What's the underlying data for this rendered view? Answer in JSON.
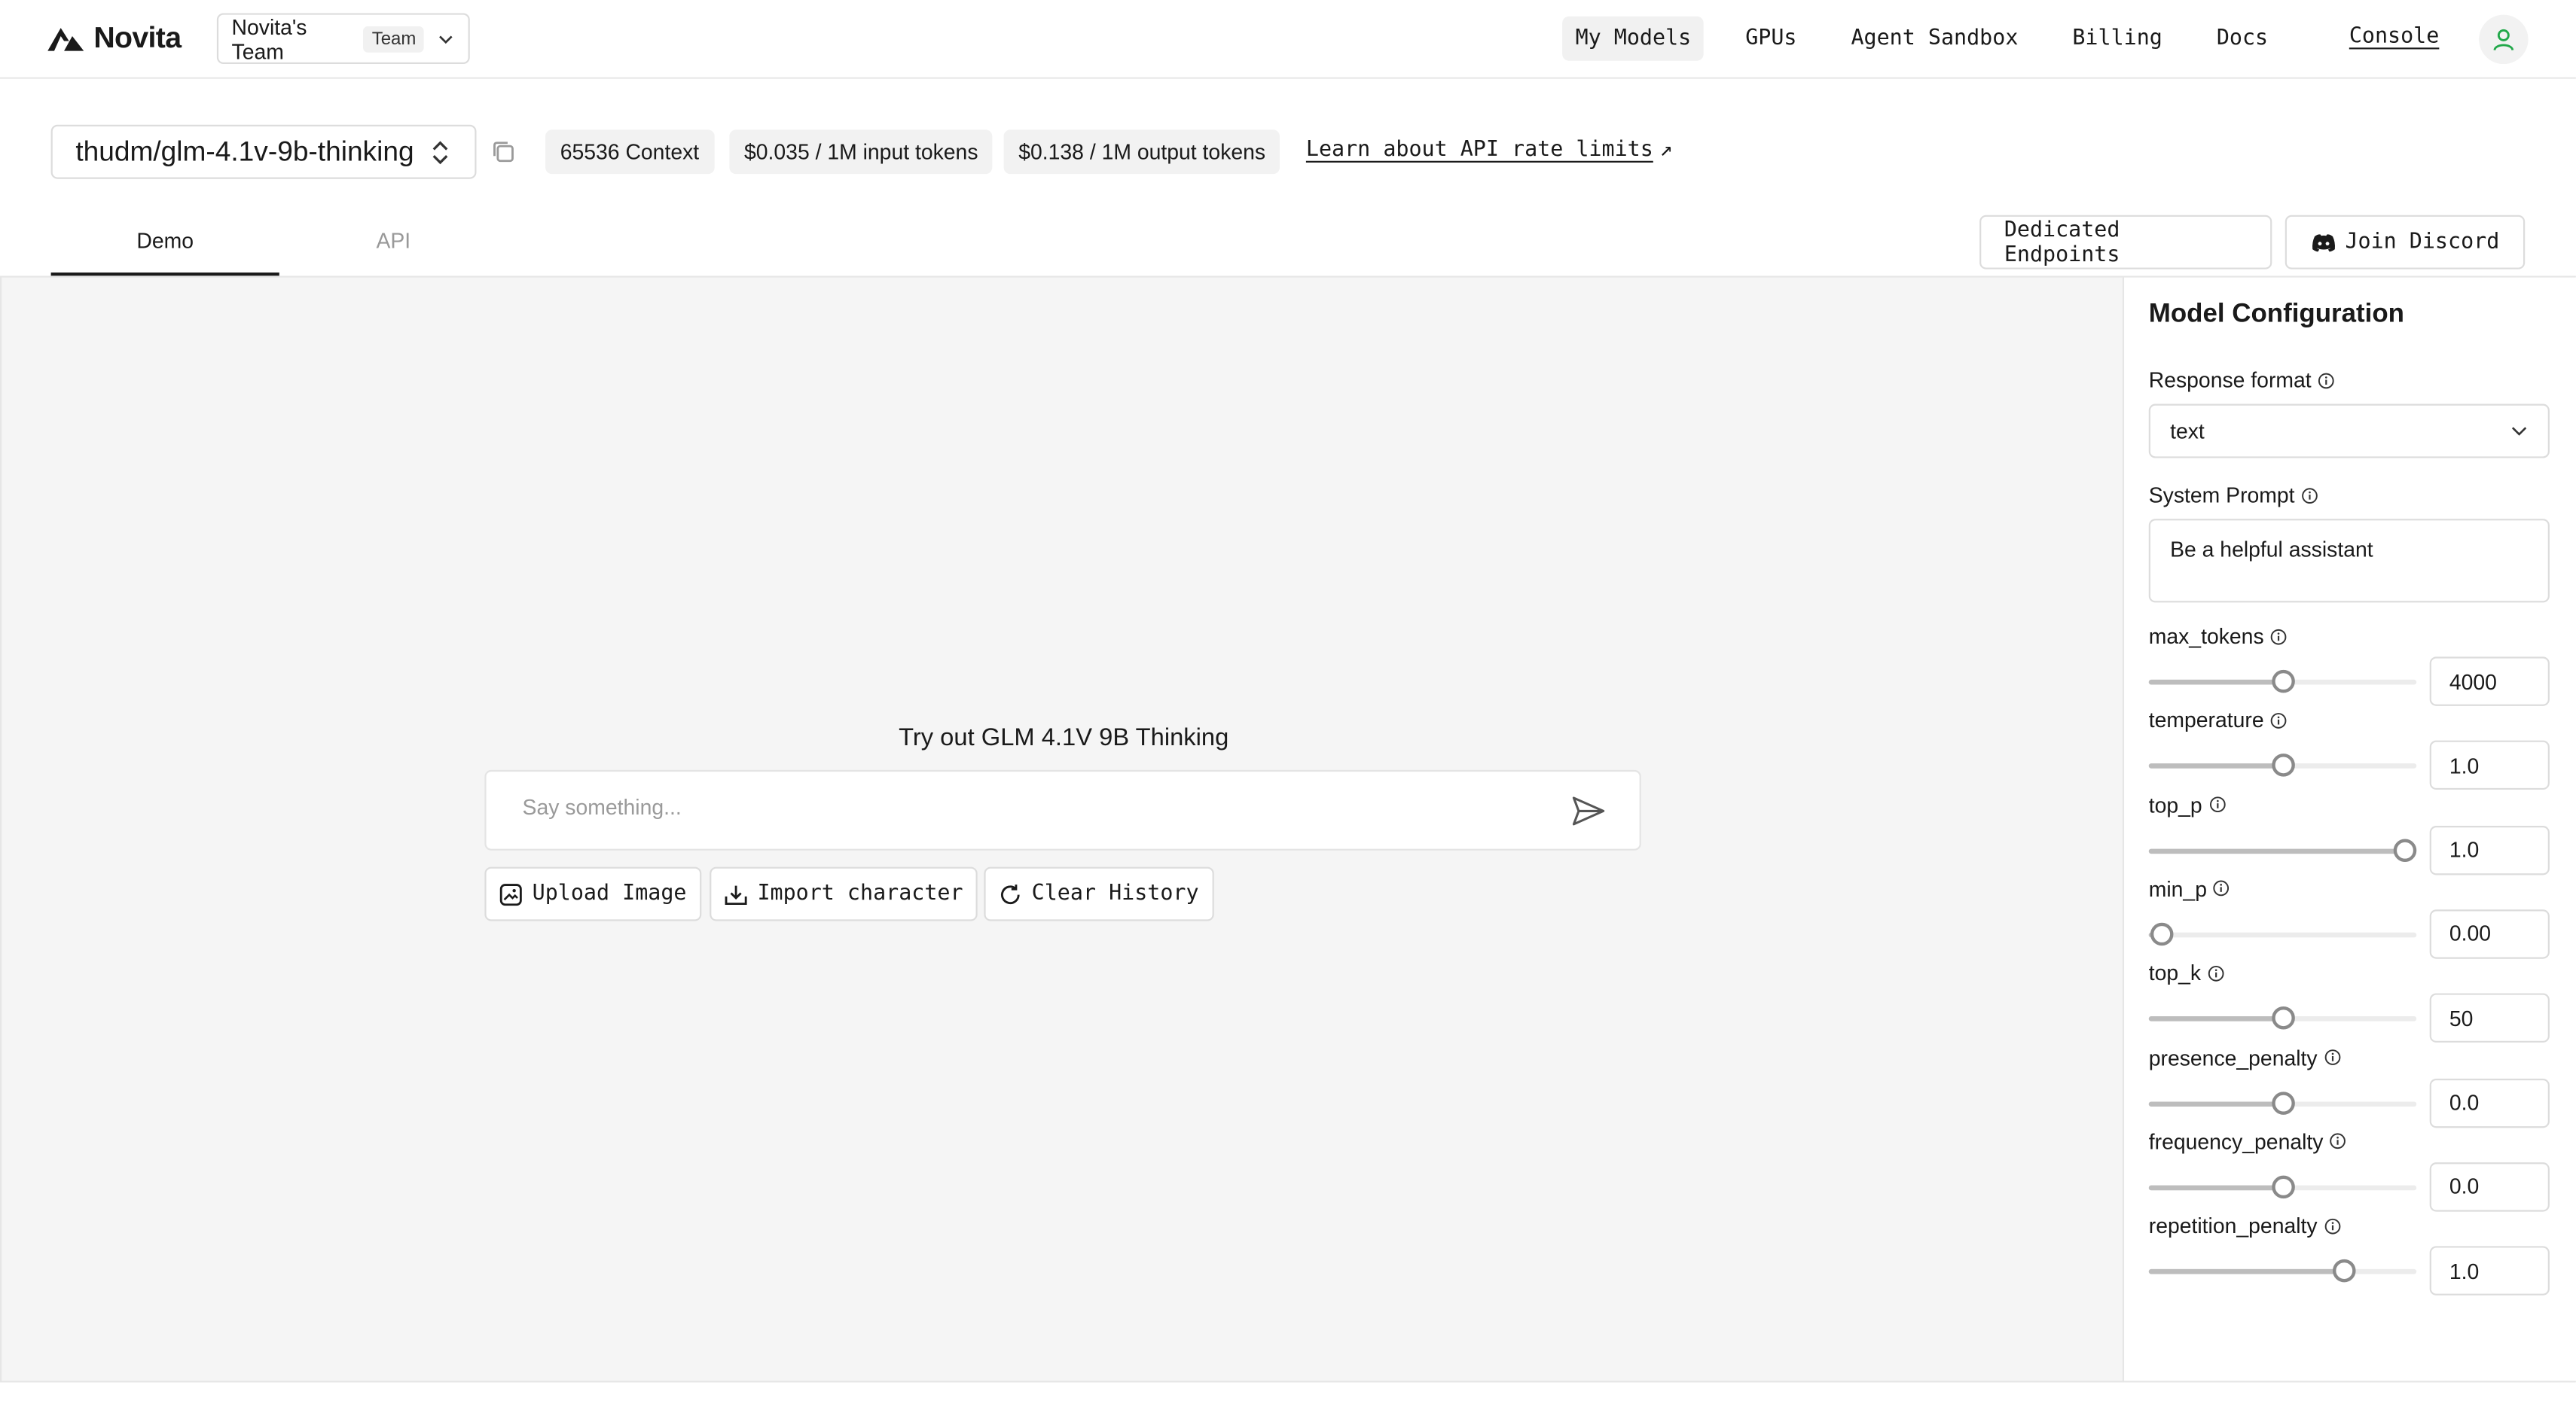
{
  "header": {
    "logo_text": "Novita",
    "team_name": "Novita's Team",
    "team_badge": "Team",
    "nav": [
      "My Models",
      "GPUs",
      "Agent Sandbox",
      "Billing",
      "Docs"
    ],
    "console": "Console",
    "accent_color": "#22a84a"
  },
  "model": {
    "name": "thudm/glm-4.1v-9b-thinking",
    "context": "65536 Context",
    "input_price": "$0.035 / 1M input tokens",
    "output_price": "$0.138 / 1M output tokens",
    "rate_link": "Learn about API rate limits",
    "rate_arrow": "↗"
  },
  "tabs": {
    "demo": "Demo",
    "api": "API",
    "dedicated": "Dedicated Endpoints",
    "discord": "Join Discord"
  },
  "demo": {
    "title": "Try out GLM 4.1V 9B Thinking",
    "placeholder": "Say something...",
    "upload": "Upload Image",
    "import": "Import character",
    "clear": "Clear History"
  },
  "config": {
    "title": "Model Configuration",
    "response_format_label": "Response format",
    "response_format_value": "text",
    "system_prompt_label": "System Prompt",
    "system_prompt_value": "Be a helpful assistant",
    "params": [
      {
        "label": "max_tokens",
        "value": "4000",
        "level": 0.5
      },
      {
        "label": "temperature",
        "value": "1.0",
        "level": 0.5
      },
      {
        "label": "top_p",
        "value": "1.0",
        "level": 0.96
      },
      {
        "label": "min_p",
        "value": "0.00",
        "level": 0.05
      },
      {
        "label": "top_k",
        "value": "50",
        "level": 0.5
      },
      {
        "label": "presence_penalty",
        "value": "0.0",
        "level": 0.5
      },
      {
        "label": "frequency_penalty",
        "value": "0.0",
        "level": 0.5
      },
      {
        "label": "repetition_penalty",
        "value": "1.0",
        "level": 0.73
      }
    ]
  }
}
